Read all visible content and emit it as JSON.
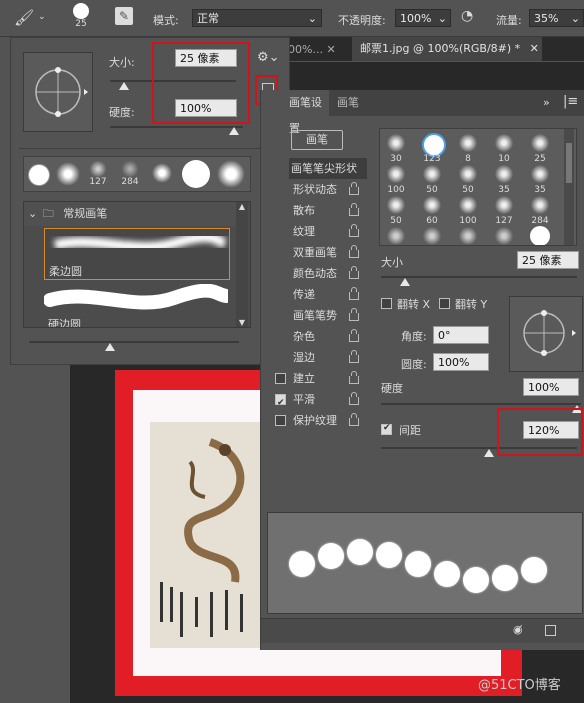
{
  "optbar": {
    "brush_size": "25",
    "mode_label": "模式:",
    "mode_value": "正常",
    "opacity_label": "不透明度:",
    "opacity_value": "100%",
    "flow_label": "流量:",
    "flow_value": "35%"
  },
  "tabs": {
    "tab1": "00%...",
    "tab2": "邮票1.jpg @ 100%(RGB/8#) *"
  },
  "preset": {
    "size_label": "大小:",
    "size_value": "25 像素",
    "hardness_label": "硬度:",
    "hardness_value": "100%",
    "folder_label": "常规画笔",
    "brush1": "柔边圆",
    "brush2": "硬边圆",
    "thumb_labels": [
      "127",
      "284"
    ]
  },
  "settings": {
    "tab_active": "画笔设置",
    "tab_other": "画笔",
    "presets_button": "画笔",
    "list": [
      "画笔笔尖形状",
      "形状动态",
      "散布",
      "纹理",
      "双重画笔",
      "颜色动态",
      "传递",
      "画笔笔势",
      "杂色",
      "湿边",
      "建立",
      "平滑",
      "保护纹理"
    ],
    "tip_labels": [
      "30",
      "123",
      "8",
      "10",
      "25",
      "100",
      "50",
      "50",
      "35",
      "35",
      "50",
      "60",
      "100",
      "127",
      "284"
    ],
    "size_label": "大小",
    "size_value": "25 像素",
    "flipx": "翻转 X",
    "flipy": "翻转 Y",
    "angle_label": "角度:",
    "angle_value": "0°",
    "round_label": "圆度:",
    "round_value": "100%",
    "hardness_label": "硬度",
    "hardness_value": "100%",
    "spacing_label": "间距",
    "spacing_value": "120%"
  },
  "watermark": "@51CTO博客",
  "colors": {
    "red": "#d3131b",
    "panel": "#535353",
    "dark": "#323232"
  }
}
